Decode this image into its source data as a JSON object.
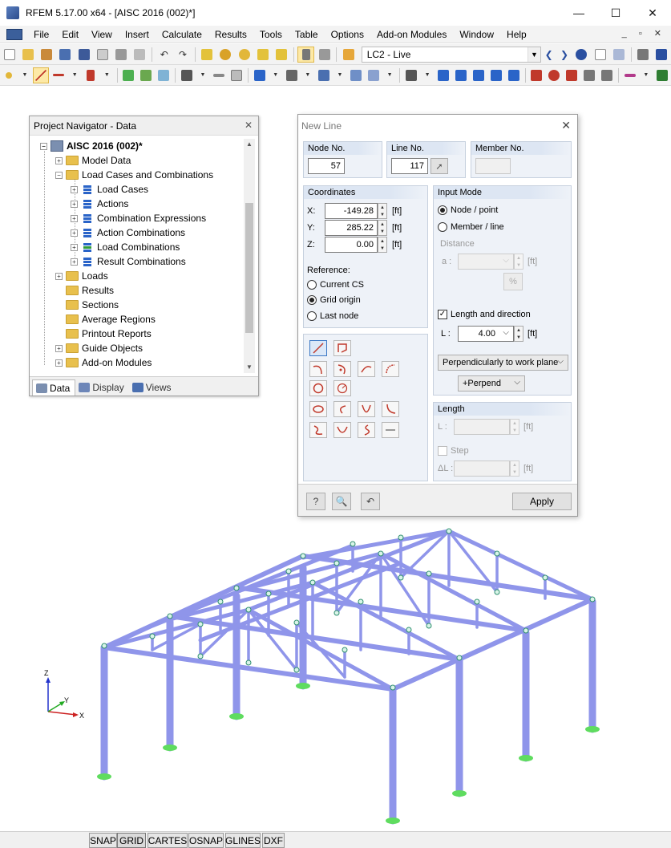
{
  "window": {
    "title": "RFEM 5.17.00 x64 - [AISC 2016 (002)*]"
  },
  "menu": [
    "File",
    "Edit",
    "View",
    "Insert",
    "Calculate",
    "Results",
    "Tools",
    "Table",
    "Options",
    "Add-on Modules",
    "Window",
    "Help"
  ],
  "toolbar": {
    "load_case": "LC2 - Live"
  },
  "navigator": {
    "title": "Project Navigator - Data",
    "root": "AISC 2016 (002)*",
    "items": [
      "Model Data",
      "Load Cases and Combinations",
      "Load Cases",
      "Actions",
      "Combination Expressions",
      "Action Combinations",
      "Load Combinations",
      "Result Combinations",
      "Loads",
      "Results",
      "Sections",
      "Average Regions",
      "Printout Reports",
      "Guide Objects",
      "Add-on Modules"
    ],
    "tabs": [
      "Data",
      "Display",
      "Views"
    ]
  },
  "dialog": {
    "title": "New Line",
    "node_no_label": "Node No.",
    "node_no": "57",
    "line_no_label": "Line No.",
    "line_no": "117",
    "member_no_label": "Member No.",
    "coordinates_label": "Coordinates",
    "x_label": "X:",
    "x_value": "-149.28",
    "y_label": "Y:",
    "y_value": "285.22",
    "z_label": "Z:",
    "z_value": "0.00",
    "unit_ft": "[ft]",
    "reference_label": "Reference:",
    "ref_current_cs": "Current CS",
    "ref_grid_origin": "Grid origin",
    "ref_last_node": "Last node",
    "input_mode_label": "Input Mode",
    "mode_node_point": "Node / point",
    "mode_member_line": "Member / line",
    "distance_label": "Distance",
    "a_label": "a :",
    "percent_btn": "%",
    "length_direction_label": "Length and direction",
    "l_label": "L :",
    "l_value": "4.00",
    "direction_value": "Perpendicularly to work plane",
    "perpend_value": "+Perpend",
    "length_label": "Length",
    "l2_label": "L :",
    "step_label": "Step",
    "dl_label": "ΔL :",
    "apply": "Apply"
  },
  "model_axes": {
    "z": "Z",
    "y": "Y",
    "x": "X"
  },
  "statusbar": [
    "SNAP",
    "GRID",
    "CARTES",
    "OSNAP",
    "GLINES",
    "DXF"
  ]
}
